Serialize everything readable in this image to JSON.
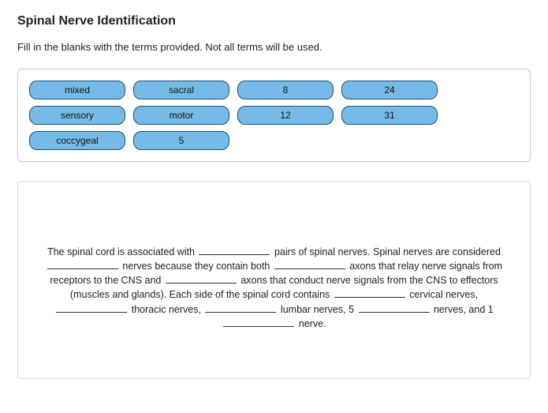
{
  "title": "Spinal Nerve Identification",
  "instructions": "Fill in the blanks with the terms provided.  Not all terms will be used.",
  "terms": {
    "rows": [
      [
        "mixed",
        "sacral",
        "8",
        "24"
      ],
      [
        "sensory",
        "motor",
        "12",
        "31"
      ],
      [
        "coccygeal",
        "5"
      ]
    ]
  },
  "paragraph": {
    "segments": [
      "The spinal cord is associated with ",
      {
        "blank": true
      },
      " pairs of spinal nerves. Spinal nerves are considered ",
      {
        "blank": true
      },
      " nerves because they contain both ",
      {
        "blank": true
      },
      " axons that relay nerve signals from receptors to the CNS and ",
      {
        "blank": true
      },
      " axons that conduct nerve signals from the CNS to effectors (muscles and glands). Each side of the spinal cord contains ",
      {
        "blank": true
      },
      " cervical nerves, ",
      {
        "blank": true
      },
      " thoracic nerves, ",
      {
        "blank": true
      },
      " lumbar nerves, 5 ",
      {
        "blank": true
      },
      " nerves, and 1 ",
      {
        "blank": true
      },
      " nerve."
    ]
  }
}
